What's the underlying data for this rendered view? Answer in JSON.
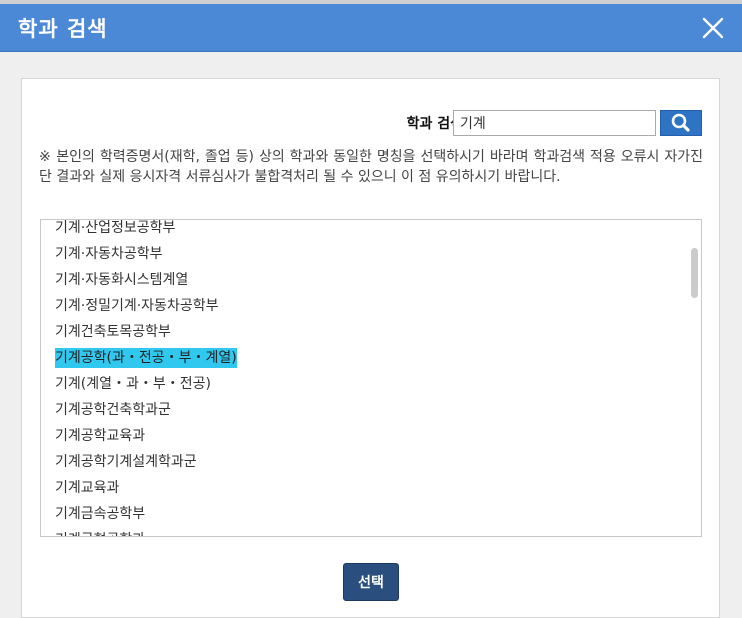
{
  "dialog": {
    "title": "학과 검색"
  },
  "search": {
    "label": "학과 검색",
    "value": "기계"
  },
  "notice": "※ 본인의 학력증명서(재학, 졸업 등) 상의 학과와 동일한 명칭을 선택하시기 바라며 학과검색 적용 오류시 자가진단 결과와 실제 응시자격 서류심사가 불합격처리 될 수 있으니 이 점 유의하시기 바랍니다.",
  "departments": [
    "기계·산업정보공학부",
    "기계·자동차공학부",
    "기계·자동화시스템계열",
    "기계·정밀기계·자동차공학부",
    "기계건축토목공학부",
    "기계공학(과・전공・부・계열)",
    "기계(계열・과・부・전공)",
    "기계공학건축학과군",
    "기계공학교육과",
    "기계공학기계설계학과군",
    "기계교육과",
    "기계금속공학부",
    "기계금형공학과"
  ],
  "selected_index": 5,
  "actions": {
    "select_label": "선택"
  },
  "colors": {
    "titlebar": "#4b88d6",
    "search_button": "#2f73c4",
    "selected_highlight": "#30c8ef",
    "select_button": "#2a4f7e"
  }
}
